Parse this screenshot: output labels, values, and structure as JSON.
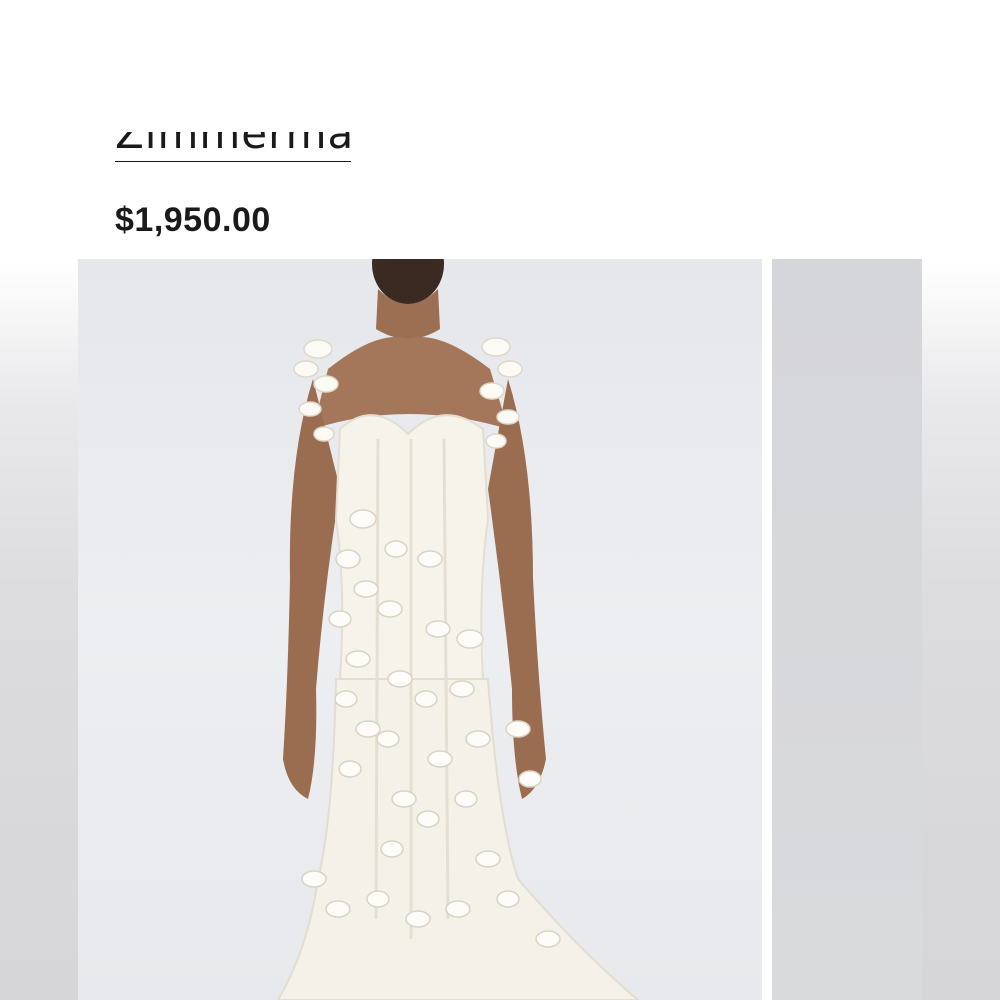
{
  "product": {
    "brand": "Zimmermann",
    "price": "$1,950.00"
  },
  "gallery": {
    "main_image_description": "Model wearing a white strapless-corset gown with cascading 3D floral petal appliqués",
    "next_image": "peek"
  },
  "colors": {
    "text": "#1a1a1a",
    "image_background": "#e9eaee",
    "dress": "#f7f5ee"
  }
}
